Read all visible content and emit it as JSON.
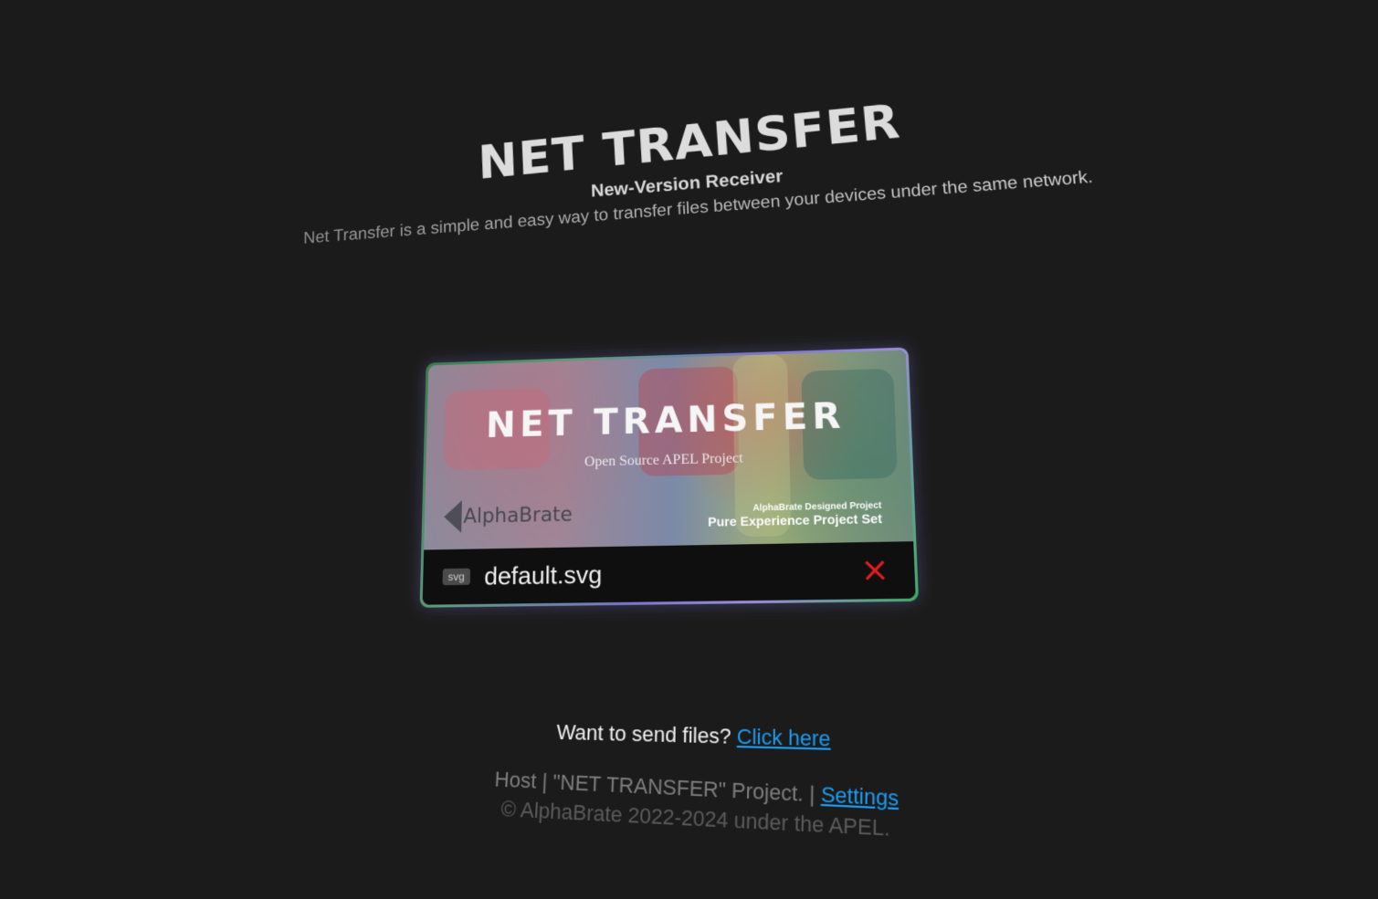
{
  "header": {
    "title": "NET TRANSFER",
    "subtitle": "New-Version Receiver",
    "description": "Net Transfer is a simple and easy way to transfer files between your devices under the same network."
  },
  "file_card": {
    "preview": {
      "title": "NET TRANSFER",
      "subtitle": "Open Source APEL Project",
      "brand": "AlphaBrate",
      "tag_small": "AlphaBrate Designed Project",
      "tag_big": "Pure Experience Project Set"
    },
    "file_type": "svg",
    "file_name": "default.svg",
    "remove_icon": "close-icon",
    "remove_color": "#e21d1d"
  },
  "send": {
    "prompt": "Want to send files?",
    "link_label": "Click here"
  },
  "footer": {
    "host_text": "Host | \"NET TRANSFER\" Project. |",
    "settings_label": "Settings",
    "copyright": "© AlphaBrate 2022-2024 under the APEL."
  },
  "colors": {
    "background": "#1b1b1b",
    "link": "#1d9bf0"
  }
}
